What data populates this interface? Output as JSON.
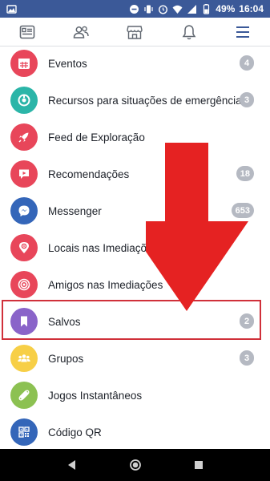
{
  "status_bar": {
    "battery": "49%",
    "time": "16:04",
    "icons": [
      "image-icon",
      "mute-icon",
      "vibrate-icon",
      "alarm-icon",
      "wifi-icon",
      "signal-icon",
      "battery-icon"
    ]
  },
  "nav": {
    "items": [
      {
        "name": "news-feed",
        "icon": "news-feed-icon"
      },
      {
        "name": "friends",
        "icon": "friends-icon"
      },
      {
        "name": "marketplace",
        "icon": "marketplace-icon"
      },
      {
        "name": "notifications",
        "icon": "bell-icon"
      },
      {
        "name": "menu",
        "icon": "hamburger-icon",
        "active": true
      }
    ],
    "accent_color": "#3b5998"
  },
  "menu": {
    "items": [
      {
        "label": "Eventos",
        "badge": "4",
        "icon": "calendar-icon",
        "color": "#e8465a"
      },
      {
        "label": "Recursos para situações de emergência",
        "badge": "3",
        "icon": "crisis-response-icon",
        "color": "#2bb5a8"
      },
      {
        "label": "Feed de Exploração",
        "badge": "",
        "icon": "rocket-icon",
        "color": "#e8465a"
      },
      {
        "label": "Recomendações",
        "badge": "18",
        "icon": "recommendation-icon",
        "color": "#e8465a"
      },
      {
        "label": "Messenger",
        "badge": "653",
        "icon": "messenger-icon",
        "color": "#3466b9"
      },
      {
        "label": "Locais nas Imediações",
        "badge": "",
        "icon": "location-pin-icon",
        "color": "#e8465a"
      },
      {
        "label": "Amigos nas Imediações",
        "badge": "",
        "icon": "radar-icon",
        "color": "#e8465a"
      },
      {
        "label": "Salvos",
        "badge": "2",
        "icon": "bookmark-icon",
        "color": "#8a64c9",
        "highlighted": true
      },
      {
        "label": "Grupos",
        "badge": "3",
        "icon": "groups-icon",
        "color": "#f7cf47"
      },
      {
        "label": "Jogos Instantâneos",
        "badge": "",
        "icon": "game-controller-icon",
        "color": "#8cc152"
      },
      {
        "label": "Código QR",
        "badge": "",
        "icon": "qr-code-icon",
        "color": "#3466b9"
      }
    ]
  },
  "annotation": {
    "arrow_color": "#e52222",
    "highlight_color": "#d0303a"
  },
  "system_bar": {
    "buttons": [
      "back-icon",
      "home-icon",
      "recents-icon"
    ]
  }
}
